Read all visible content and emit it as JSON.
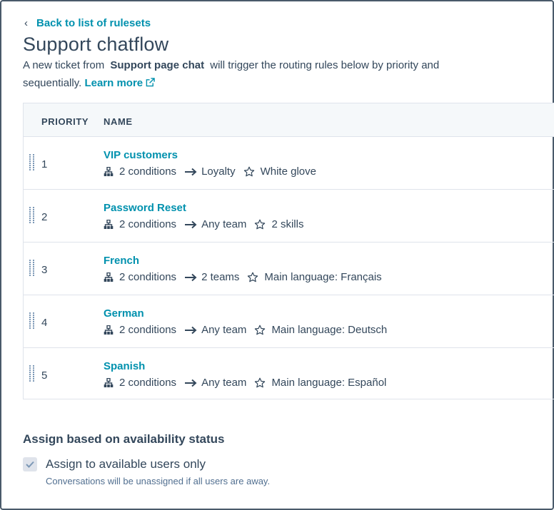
{
  "back_link": {
    "label": "Back to list of rulesets"
  },
  "title": "Support chatflow",
  "description": {
    "prefix": "A new ticket from",
    "source": "Support page chat",
    "middle": "will trigger the routing rules below by priority and sequentially.",
    "learn_more": "Learn more"
  },
  "table": {
    "headers": {
      "priority": "PRIORITY",
      "name": "NAME"
    },
    "rows": [
      {
        "priority": "1",
        "name": "VIP customers",
        "conditions": "2 conditions",
        "target": "Loyalty",
        "skill": "White glove"
      },
      {
        "priority": "2",
        "name": "Password Reset",
        "conditions": "2 conditions",
        "target": "Any team",
        "skill": "2 skills"
      },
      {
        "priority": "3",
        "name": "French",
        "conditions": "2 conditions",
        "target": "2 teams",
        "skill": "Main language: Français"
      },
      {
        "priority": "4",
        "name": "German",
        "conditions": "2 conditions",
        "target": "Any team",
        "skill": "Main language: Deutsch"
      },
      {
        "priority": "5",
        "name": "Spanish",
        "conditions": "2 conditions",
        "target": "Any team",
        "skill": "Main language: Español"
      }
    ]
  },
  "availability": {
    "title": "Assign based on availability status",
    "checkbox_label": "Assign to available users only",
    "checked": true,
    "help": "Conversations will be unassigned if all users are away."
  },
  "icons": {
    "back": "chevron-left-icon",
    "external": "external-link-icon",
    "drag": "drag-handle-icon",
    "conditions": "hierarchy-icon",
    "arrow": "arrow-right-icon",
    "skill": "star-outline-icon",
    "check": "checkmark-icon"
  },
  "colors": {
    "link": "#0091ae",
    "text": "#33475b",
    "header_bg": "#f5f8fa",
    "border": "#dfe3eb"
  }
}
